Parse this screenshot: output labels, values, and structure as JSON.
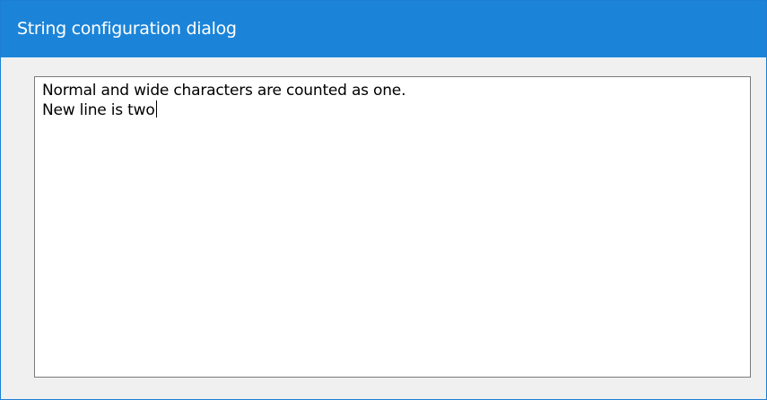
{
  "window": {
    "title": "String configuration dialog"
  },
  "editor": {
    "lines": [
      "Normal and wide characters are counted as one.",
      "New line is two"
    ]
  },
  "colors": {
    "titlebar": "#1c84d8",
    "window_border": "#1c7fd4",
    "client_background": "#f0f0f0",
    "text_background": "#ffffff"
  }
}
